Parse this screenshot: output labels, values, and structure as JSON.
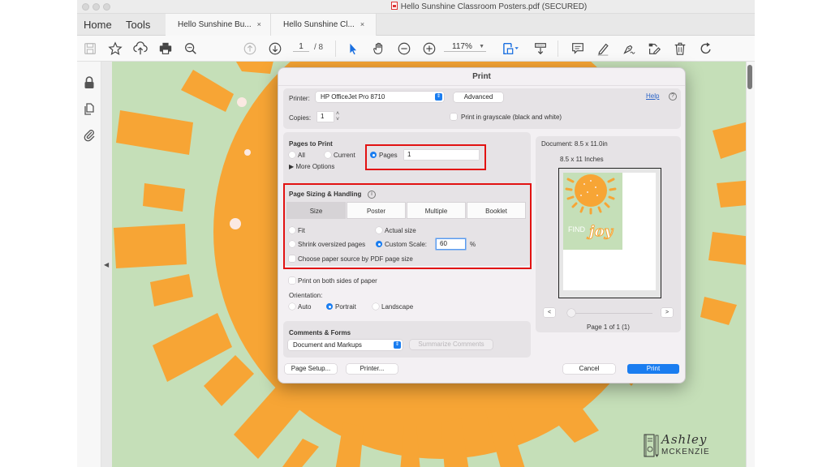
{
  "window": {
    "title": "Hello Sunshine Classroom Posters.pdf (SECURED)"
  },
  "tabs": {
    "home": "Home",
    "tools": "Tools",
    "documents": [
      {
        "label": "Hello Sunshine Bu...",
        "close": "×"
      },
      {
        "label": "Hello Sunshine Cl...",
        "close": "×"
      }
    ]
  },
  "toolbar": {
    "icons": [
      "save-icon",
      "star-icon",
      "cloud-upload-icon",
      "print-icon",
      "zoom-search-icon",
      "page-up-icon",
      "page-down-icon",
      "select-arrow-icon",
      "hand-icon",
      "zoom-out-icon",
      "zoom-in-icon",
      "fit-page-icon",
      "scroll-mode-icon",
      "comment-icon",
      "highlight-icon",
      "sign-icon",
      "fill-sign-icon",
      "delete-icon",
      "rotate-icon"
    ],
    "current_page": "1",
    "total_pages": "/ 8",
    "zoom_level": "117%"
  },
  "left_rail": {
    "icons": [
      "lock-icon",
      "pages-icon",
      "attachment-icon"
    ]
  },
  "print_dialog": {
    "title": "Print",
    "printer_label": "Printer:",
    "printer_value": "HP OfficeJet Pro 8710",
    "advanced_button": "Advanced",
    "help_link": "Help",
    "help_icon": "?",
    "copies_label": "Copies:",
    "copies_value": "1",
    "grayscale_label": "Print in grayscale (black and white)",
    "grayscale_checked": false,
    "pages_to_print": {
      "heading": "Pages to Print",
      "all": "All",
      "current": "Current",
      "pages": "Pages",
      "pages_value": "1",
      "selected": "Pages",
      "more_options": "More Options"
    },
    "page_sizing": {
      "heading": "Page Sizing & Handling",
      "info_icon": "i",
      "segments": [
        "Size",
        "Poster",
        "Multiple",
        "Booklet"
      ],
      "active_segment": "Size",
      "fit": "Fit",
      "actual_size": "Actual size",
      "shrink": "Shrink oversized pages",
      "custom_scale": "Custom Scale:",
      "custom_scale_value": "60",
      "percent": "%",
      "selected": "Custom Scale",
      "paper_source": "Choose paper source by PDF page size",
      "paper_source_checked": false
    },
    "both_sides": "Print on both sides of paper",
    "both_sides_checked": false,
    "orientation": {
      "label": "Orientation:",
      "auto": "Auto",
      "portrait": "Portrait",
      "landscape": "Landscape",
      "selected": "Portrait"
    },
    "comments_forms": {
      "heading": "Comments & Forms",
      "value": "Document and Markups",
      "summarize_button": "Summarize Comments"
    },
    "preview": {
      "document_size": "Document: 8.5 x 11.0in",
      "paper_size": "8.5 x 11 Inches",
      "prev": "<",
      "next": ">",
      "page_status": "Page 1 of 1 (1)",
      "poster_text_1": "FIND",
      "poster_text_2": "joy"
    },
    "page_setup_button": "Page Setup...",
    "printer_button": "Printer...",
    "cancel_button": "Cancel",
    "print_button": "Print"
  },
  "watermark": {
    "line1": "Ashley",
    "line2": "MCKENZIE"
  },
  "colors": {
    "accent_blue": "#1a7df0",
    "highlight_red": "#e21212",
    "sun_orange": "#f7a535",
    "background_green": "#c5dfb8"
  }
}
